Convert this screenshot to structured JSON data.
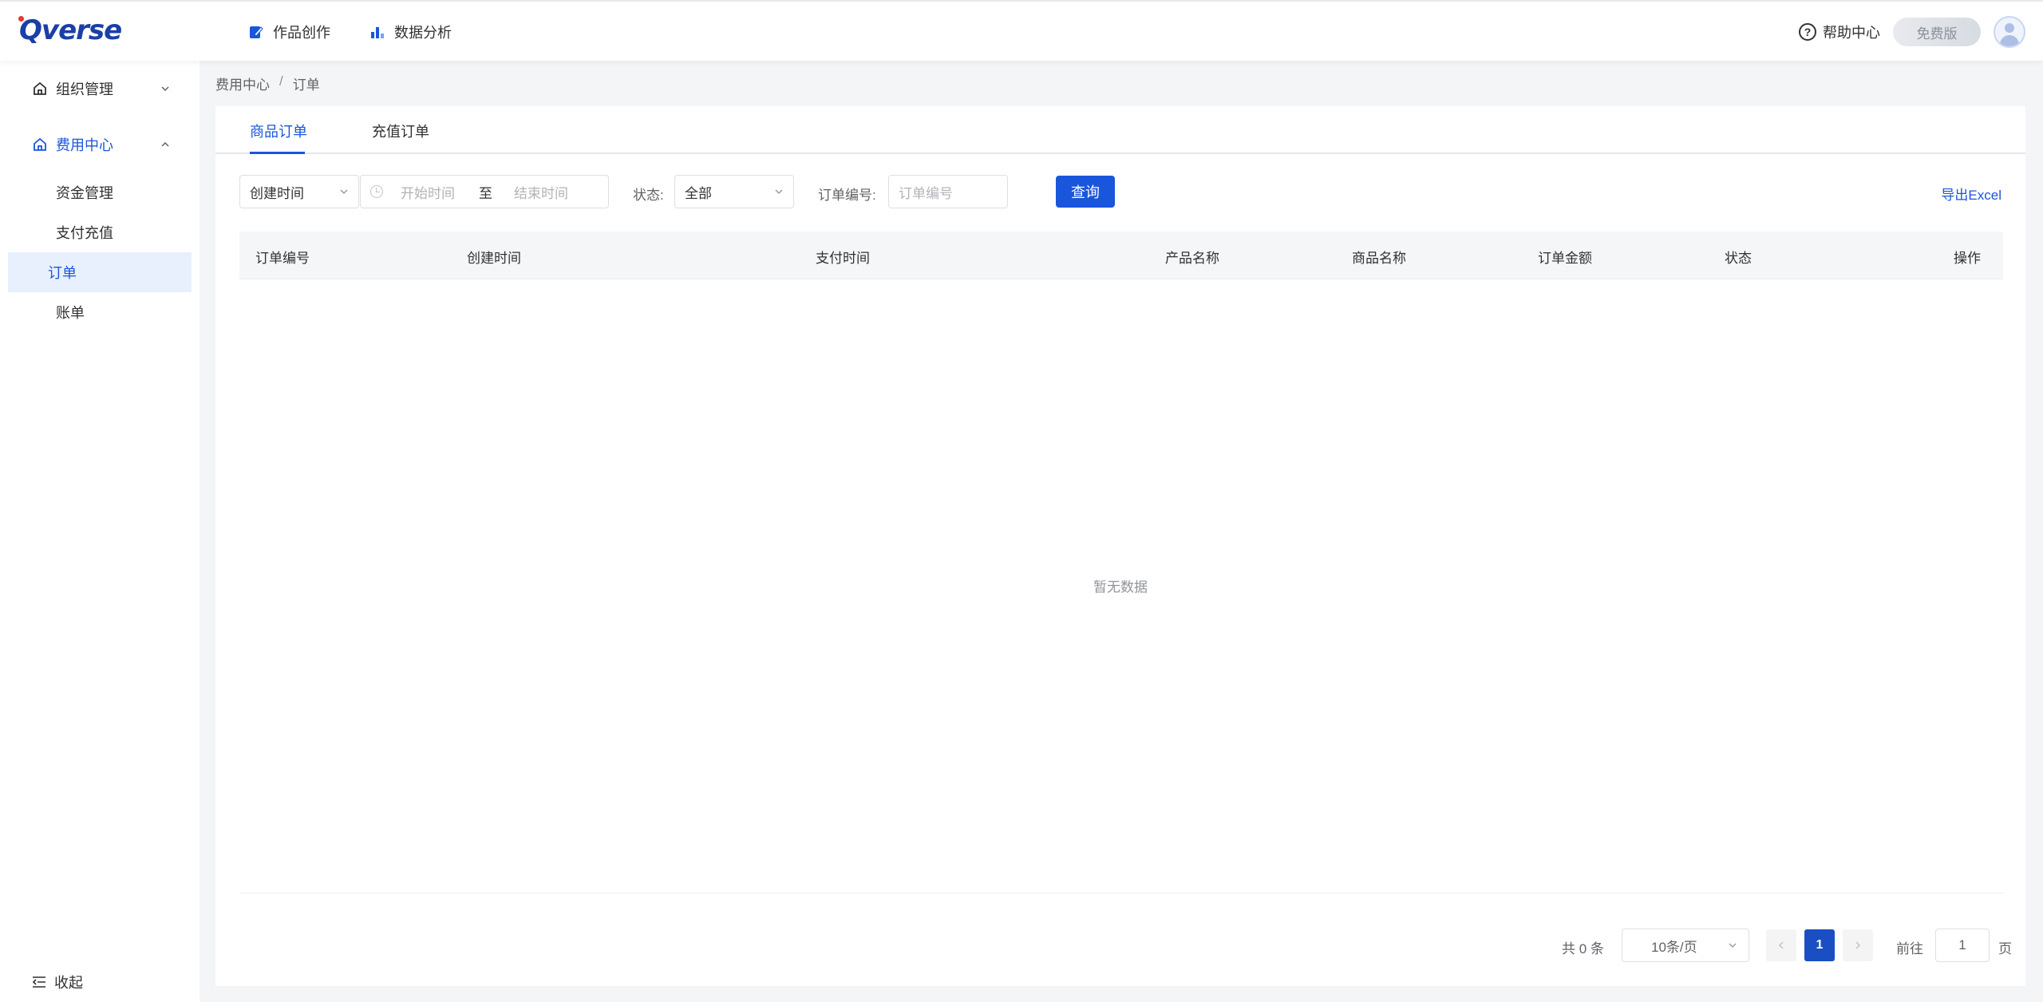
{
  "header": {
    "logo": "Qverse",
    "nav": [
      {
        "label": "作品创作",
        "icon": "edit-icon"
      },
      {
        "label": "数据分析",
        "icon": "bar-chart-icon"
      }
    ],
    "help_label": "帮助中心",
    "plan_label": "免费版"
  },
  "sidebar": {
    "groups": [
      {
        "label": "组织管理",
        "icon": "home-icon",
        "expanded": false
      },
      {
        "label": "费用中心",
        "icon": "home-icon",
        "expanded": true
      }
    ],
    "items": [
      {
        "label": "资金管理"
      },
      {
        "label": "支付充值"
      },
      {
        "label": "订单",
        "active": true
      },
      {
        "label": "账单"
      }
    ],
    "collapse_label": "收起"
  },
  "breadcrumb": [
    "费用中心",
    "订单"
  ],
  "tabs": [
    {
      "label": "商品订单",
      "active": true
    },
    {
      "label": "充值订单"
    }
  ],
  "filters": {
    "time_type": "创建时间",
    "start_placeholder": "开始时间",
    "range_separator": "至",
    "end_placeholder": "结束时间",
    "status_label": "状态:",
    "status_value": "全部",
    "order_no_label": "订单编号:",
    "order_no_placeholder": "订单编号",
    "query_label": "查询",
    "export_label": "导出Excel"
  },
  "table": {
    "columns": [
      "订单编号",
      "创建时间",
      "支付时间",
      "产品名称",
      "商品名称",
      "订单金额",
      "状态",
      "操作"
    ],
    "rows": [],
    "empty_text": "暂无数据"
  },
  "pagination": {
    "total_text": "共 0 条",
    "page_size": "10条/页",
    "current_page": "1",
    "goto_label": "前往",
    "goto_value": "1",
    "page_suffix": "页"
  },
  "colors": {
    "accent": "#1a56db",
    "active_bg": "#e8f0fe"
  }
}
